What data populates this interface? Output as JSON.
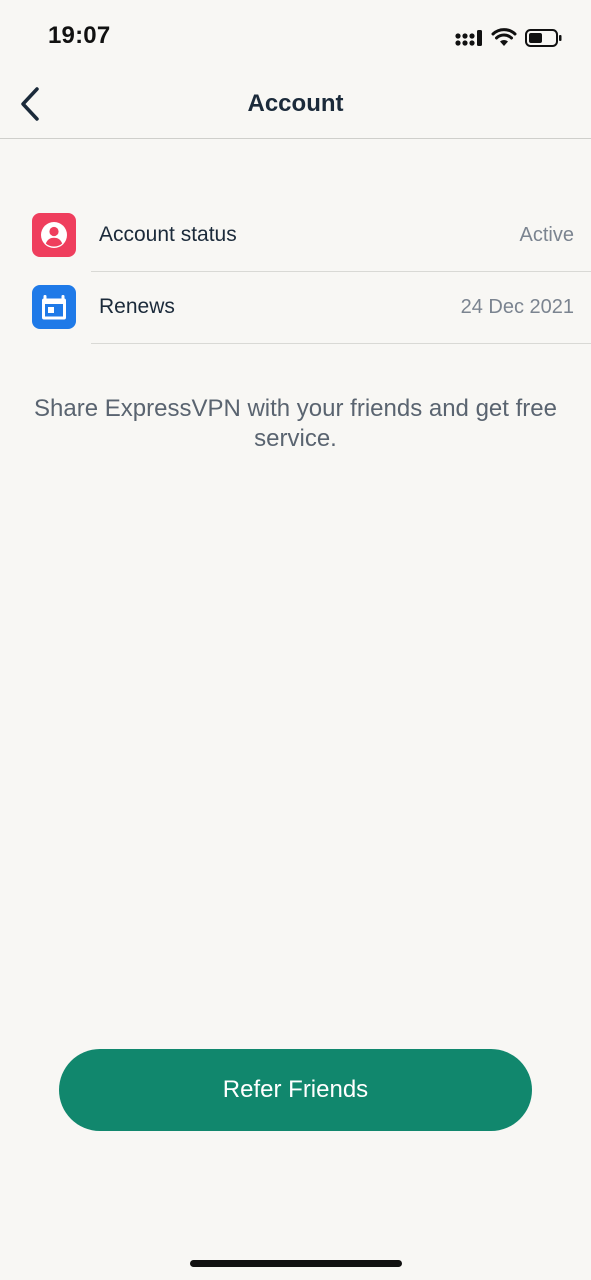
{
  "status_bar": {
    "time": "19:07",
    "icons": [
      "signal-icon",
      "wifi-icon",
      "battery-icon"
    ]
  },
  "nav": {
    "title": "Account",
    "back_icon": "chevron-left-icon"
  },
  "account_list": [
    {
      "label": "Account status",
      "value": "Active",
      "icon": "user-circle-icon",
      "icon_color": "#ef3e5d"
    },
    {
      "label": "Renews",
      "value": "24 Dec 2021",
      "icon": "calendar-icon",
      "icon_color": "#1f7ae8"
    }
  ],
  "share_message": "Share ExpressVPN with your friends and get free service.",
  "refer_button_label": "Refer Friends",
  "colors": {
    "background": "#f8f7f4",
    "accent_button": "#11876d",
    "text_primary": "#1b2a3a",
    "text_secondary": "#7b8490"
  }
}
